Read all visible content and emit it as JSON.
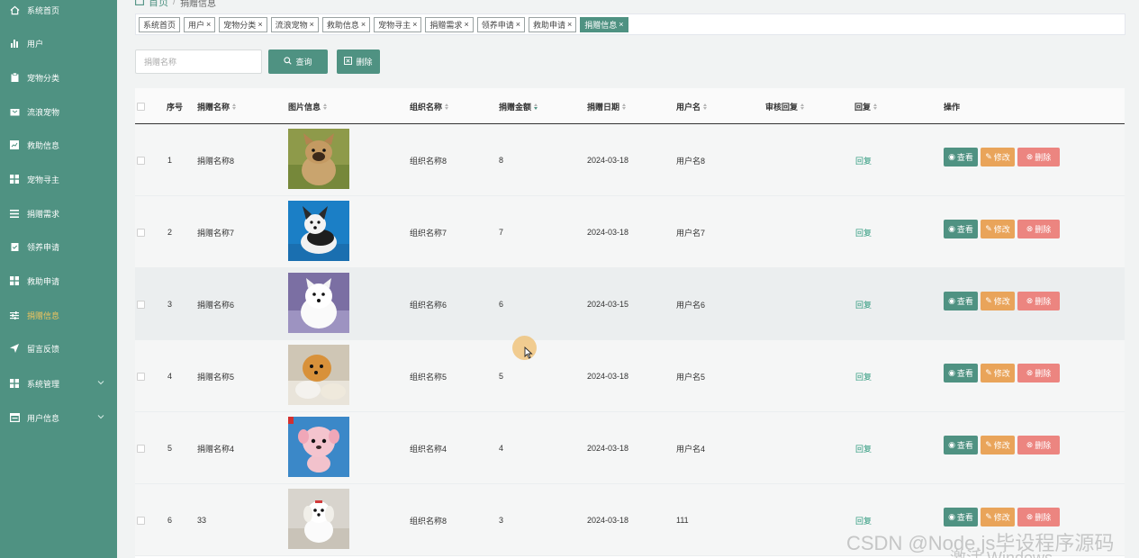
{
  "breadcrumb": {
    "home": "首页",
    "current": "捐赠信息"
  },
  "sidebar": {
    "items": [
      {
        "label": "系统首页",
        "icon": "home-icon"
      },
      {
        "label": "用户",
        "icon": "bar-chart-icon"
      },
      {
        "label": "宠物分类",
        "icon": "clipboard-icon"
      },
      {
        "label": "流浪宠物",
        "icon": "inbox-icon"
      },
      {
        "label": "救助信息",
        "icon": "chart-square-icon"
      },
      {
        "label": "宠物寻主",
        "icon": "grid-icon"
      },
      {
        "label": "捐赠需求",
        "icon": "list-icon"
      },
      {
        "label": "领养申请",
        "icon": "check-clipboard-icon"
      },
      {
        "label": "救助申请",
        "icon": "grid-icon"
      },
      {
        "label": "捐赠信息",
        "icon": "sliders-icon",
        "active": true
      },
      {
        "label": "留言反馈",
        "icon": "send-icon"
      },
      {
        "label": "系统管理",
        "icon": "grid-icon",
        "submenu": true
      },
      {
        "label": "用户信息",
        "icon": "window-icon",
        "submenu": true
      }
    ]
  },
  "tags": [
    {
      "label": "系统首页",
      "closable": false
    },
    {
      "label": "用户",
      "closable": true
    },
    {
      "label": "宠物分类",
      "closable": true
    },
    {
      "label": "流浪宠物",
      "closable": true
    },
    {
      "label": "救助信息",
      "closable": true
    },
    {
      "label": "宠物寻主",
      "closable": true
    },
    {
      "label": "捐赠需求",
      "closable": true
    },
    {
      "label": "领养申请",
      "closable": true
    },
    {
      "label": "救助申请",
      "closable": true
    },
    {
      "label": "捐赠信息",
      "closable": true,
      "active": true
    }
  ],
  "search": {
    "placeholder": "捐赠名称",
    "value": "",
    "query_label": "查询",
    "delete_label": "删除"
  },
  "table": {
    "headers": {
      "index": "序号",
      "name": "捐赠名称",
      "image": "图片信息",
      "org": "组织名称",
      "amount": "捐赠金额",
      "date": "捐赠日期",
      "user": "用户名",
      "review": "审核回复",
      "reply": "回复",
      "ops": "操作"
    },
    "rows": [
      {
        "index": "1",
        "name": "捐赠名称8",
        "org": "组织名称8",
        "amount": "8",
        "date": "2024-03-18",
        "user": "用户名8",
        "review": "",
        "reply": "回复",
        "image": "french-bulldog"
      },
      {
        "index": "2",
        "name": "捐赠名称7",
        "org": "组织名称7",
        "amount": "7",
        "date": "2024-03-18",
        "user": "用户名7",
        "review": "",
        "reply": "回复",
        "image": "corgi-puppy"
      },
      {
        "index": "3",
        "name": "捐赠名称6",
        "org": "组织名称6",
        "amount": "6",
        "date": "2024-03-15",
        "user": "用户名6",
        "review": "",
        "reply": "回复",
        "image": "samoyed-puppy"
      },
      {
        "index": "4",
        "name": "捐赠名称5",
        "org": "组织名称5",
        "amount": "5",
        "date": "2024-03-18",
        "user": "用户名5",
        "review": "",
        "reply": "回复",
        "image": "pomeranian"
      },
      {
        "index": "5",
        "name": "捐赠名称4",
        "org": "组织名称4",
        "amount": "4",
        "date": "2024-03-18",
        "user": "用户名4",
        "review": "",
        "reply": "回复",
        "image": "pink-toy-dog"
      },
      {
        "index": "6",
        "name": "33",
        "org": "组织名称8",
        "amount": "3",
        "date": "2024-03-18",
        "user": "111",
        "review": "",
        "reply": "回复",
        "image": "maltese-puppy"
      }
    ],
    "actions": {
      "view": "查看",
      "edit": "修改",
      "delete": "删除"
    }
  },
  "colors": {
    "primary": "#4f9282",
    "active_menu": "#f0c45e",
    "edit": "#e9a45a",
    "delete": "#ec8580",
    "reply": "#2f9a7e"
  },
  "watermark": {
    "csdn": "CSDN @Node.js毕设程序源码",
    "windows": "激活 Windows"
  }
}
